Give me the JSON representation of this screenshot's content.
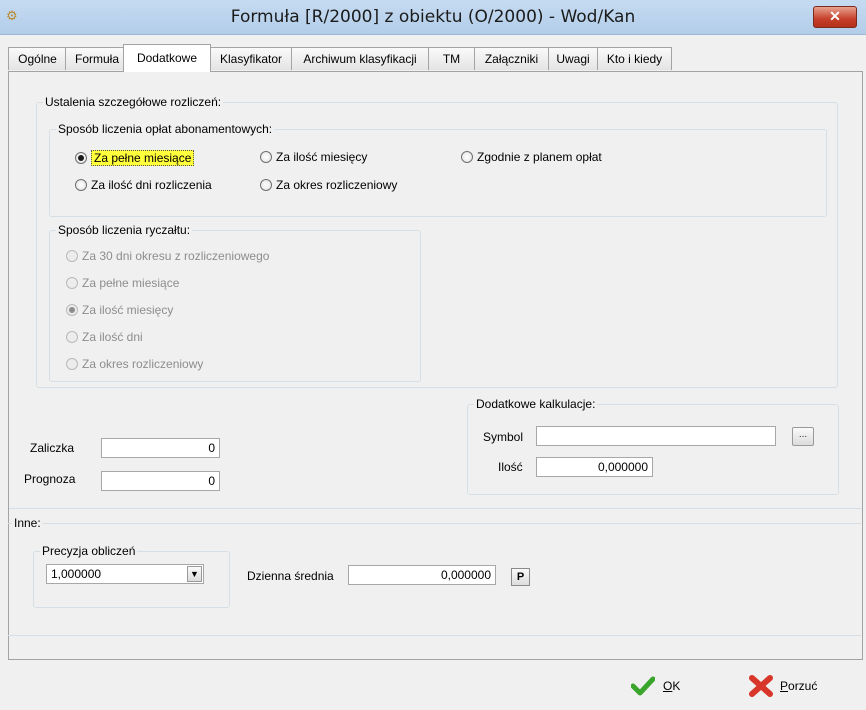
{
  "window": {
    "title": "Formuła [R/2000] z obiektu (O/2000) - Wod/Kan",
    "close_label": "✕"
  },
  "tabs": [
    {
      "label": "Ogólne"
    },
    {
      "label": "Formuła"
    },
    {
      "label": "Dodatkowe"
    },
    {
      "label": "Klasyfikator"
    },
    {
      "label": "Archiwum klasyfikacji"
    },
    {
      "label": "TM"
    },
    {
      "label": "Załączniki"
    },
    {
      "label": "Uwagi"
    },
    {
      "label": "Kto i kiedy"
    }
  ],
  "settlement": {
    "group_title": "Ustalenia szczegółowe rozliczeń:",
    "subscription": {
      "title": "Sposób liczenia opłat abonamentowych:",
      "options": [
        {
          "label": "Za pełne miesiące",
          "selected": true
        },
        {
          "label": "Za ilość miesięcy",
          "selected": false
        },
        {
          "label": "Zgodnie z planem opłat",
          "selected": false
        },
        {
          "label": "Za ilość dni rozliczenia",
          "selected": false
        },
        {
          "label": "Za okres rozliczeniowy",
          "selected": false
        }
      ]
    },
    "lump_sum": {
      "title": "Sposób liczenia ryczałtu:",
      "options": [
        {
          "label": "Za 30 dni okresu z rozliczeniowego",
          "selected": false
        },
        {
          "label": "Za pełne miesiące",
          "selected": false
        },
        {
          "label": "Za ilość miesięcy",
          "selected": true
        },
        {
          "label": "Za ilość dni",
          "selected": false
        },
        {
          "label": "Za okres rozliczeniowy",
          "selected": false
        }
      ]
    }
  },
  "advance": {
    "label": "Zaliczka",
    "value": "0"
  },
  "forecast": {
    "label": "Prognoza",
    "value": "0"
  },
  "extra_calc": {
    "title": "Dodatkowe kalkulacje:",
    "symbol_label": "Symbol",
    "symbol_value": "",
    "browse_label": "...",
    "qty_label": "Ilość",
    "qty_value": "0,000000"
  },
  "other": {
    "title": "Inne:",
    "precision_title": "Precyzja obliczeń",
    "precision_value": "1,000000",
    "daily_avg_label": "Dzienna średnia",
    "daily_avg_value": "0,000000",
    "p_label": "P"
  },
  "buttons": {
    "ok": "OK",
    "cancel": "Porzuć"
  },
  "colors": {
    "highlight": "#ffff3c",
    "ok_green": "#3aa52b",
    "cancel_red": "#d8362a"
  }
}
